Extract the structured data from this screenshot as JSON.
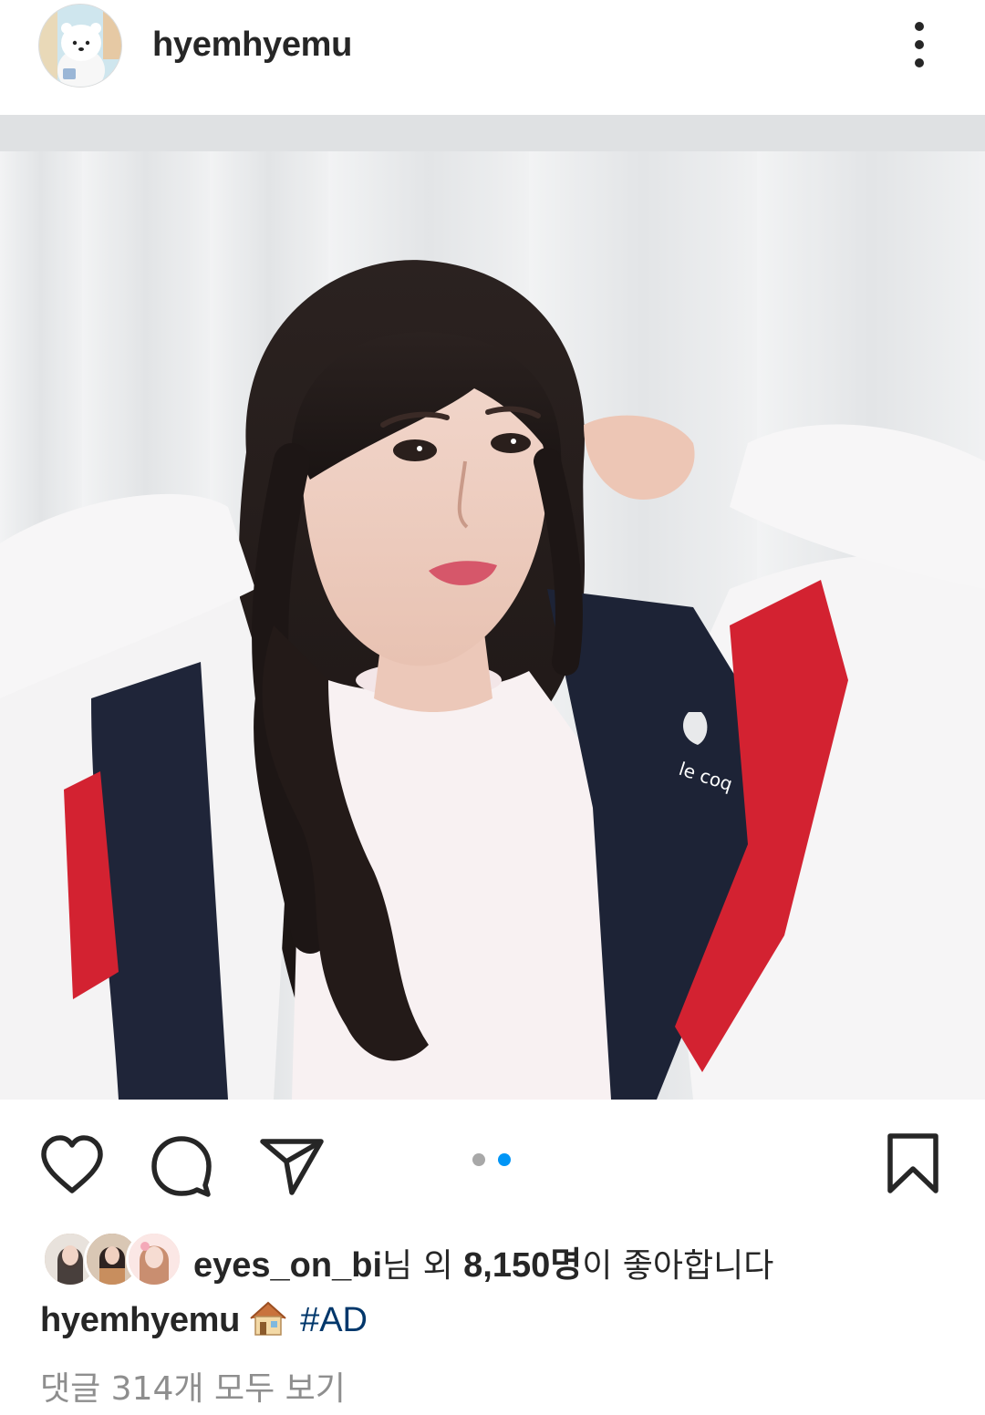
{
  "header": {
    "username": "hyemhyemu",
    "avatar_icon": "polar-bear-avatar",
    "more_icon": "more-vertical-icon"
  },
  "post": {
    "media_indicator": {
      "count": 2,
      "active_index": 1
    },
    "active_dot_color": "#0095f6",
    "inactive_dot_color": "#a8a8a8",
    "photo_brand_text": "le coq"
  },
  "actions": {
    "like_icon": "heart-icon",
    "comment_icon": "comment-bubble-icon",
    "share_icon": "paper-plane-icon",
    "save_icon": "bookmark-icon"
  },
  "likes": {
    "first_liker": "eyes_on_bi",
    "suffix_1": "님 외 ",
    "count": "8,150명",
    "suffix_2": "이 좋아합니다"
  },
  "caption": {
    "username": "hyemhyemu",
    "emoji": "house-emoji",
    "hashtag": "#AD"
  },
  "comments": {
    "view_all_label": "댓글 314개 모두 보기"
  }
}
